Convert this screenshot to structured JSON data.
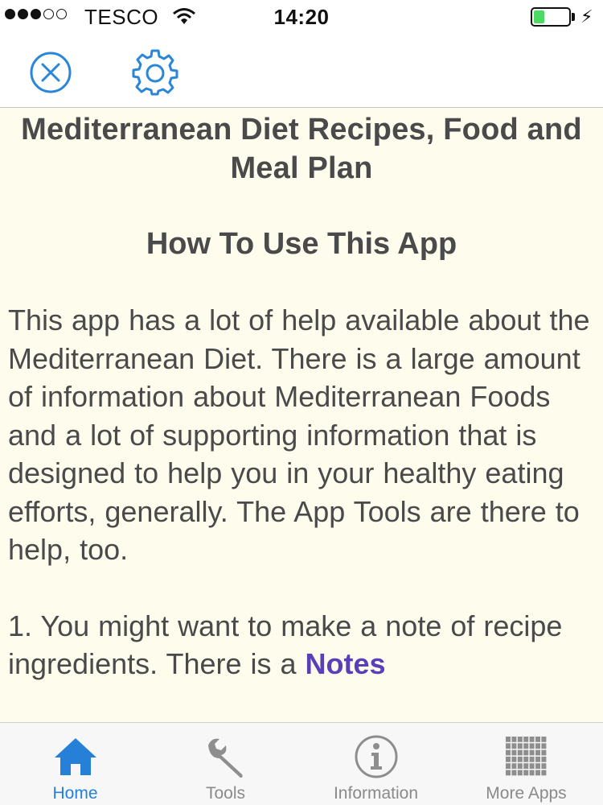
{
  "status_bar": {
    "carrier": "TESCO",
    "time": "14:20",
    "signal_bars_filled": 3,
    "signal_bars_total": 5,
    "battery_level": 0.3,
    "battery_color": "#4cd964"
  },
  "toolbar": {
    "close_icon": "close-circle-icon",
    "settings_icon": "gear-icon",
    "accent_color": "#2a86d8"
  },
  "content": {
    "title": "Mediterranean Diet Recipes, Food and Meal Plan",
    "subtitle": "How To Use This App",
    "paragraph1": "This app has a lot of help available about the Mediterranean Diet. There is a large amount of information about Mediterranean Foods and a lot of supporting information that is designed to help you in your healthy eating efforts, generally. The App Tools are there to help, too.",
    "paragraph2_text": "1. You might want to make a note of recipe ingredients. There is a ",
    "paragraph2_link": "Notes",
    "background_color": "#fdfced",
    "link_color": "#5a3fb8"
  },
  "tabbar": {
    "tabs": [
      {
        "label": "Home",
        "icon": "home-icon",
        "active": true
      },
      {
        "label": "Tools",
        "icon": "wrench-icon",
        "active": false
      },
      {
        "label": "Information",
        "icon": "info-icon",
        "active": false
      },
      {
        "label": "More Apps",
        "icon": "grid-icon",
        "active": false
      }
    ],
    "active_color": "#2680d8"
  }
}
